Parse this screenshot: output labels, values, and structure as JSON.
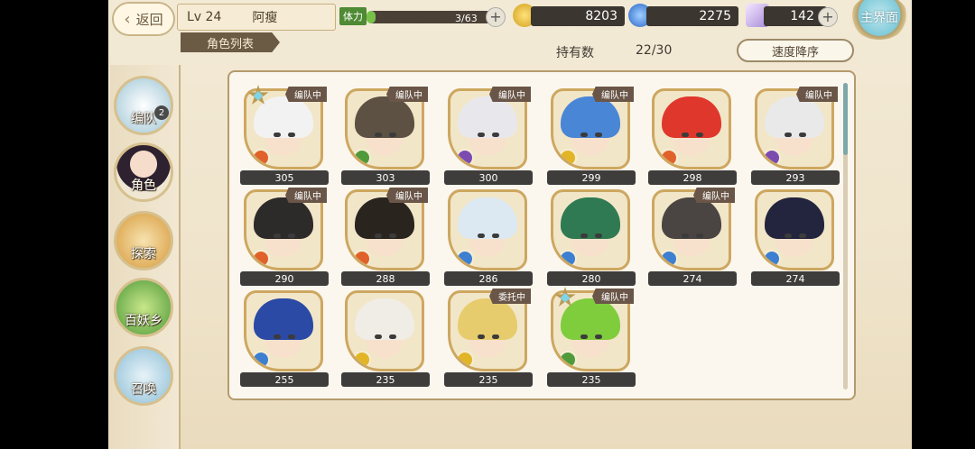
{
  "header": {
    "back_label": "返回",
    "level": "Lv 24",
    "player_name": "阿瘦",
    "section_tab": "角色列表",
    "stamina_label": "体力",
    "stamina_value": "3/63",
    "stamina_fill": 0.05,
    "gold": "8203",
    "soul": "2275",
    "crystal": "142",
    "home_label": "主界面"
  },
  "toolbar": {
    "count_label": "持有数",
    "count_value": "22/30",
    "sort_label": "速度降序"
  },
  "sidebar": {
    "items": [
      {
        "label": "编队",
        "icon": "formation-icon",
        "badge": "2"
      },
      {
        "label": "角色",
        "icon": "character-icon"
      },
      {
        "label": "探索",
        "icon": "explore-icon"
      },
      {
        "label": "百妖乡",
        "icon": "village-icon"
      },
      {
        "label": "召唤",
        "icon": "summon-icon"
      }
    ]
  },
  "colors": {
    "fire": "#e0622a",
    "wind": "#4f9a3a",
    "water": "#3d7fd0",
    "light": "#e1b526",
    "dark": "#7b4bb0"
  },
  "characters": [
    {
      "score": "305",
      "tag": "编队中",
      "star": true,
      "element": "fire",
      "hair": "#f2f2f2"
    },
    {
      "score": "303",
      "tag": "编队中",
      "element": "wind",
      "hair": "#5d5143"
    },
    {
      "score": "300",
      "tag": "编队中",
      "element": "dark",
      "hair": "#e8e8ec"
    },
    {
      "score": "299",
      "tag": "编队中",
      "element": "light",
      "hair": "#4a86d6"
    },
    {
      "score": "298",
      "tag": "",
      "element": "fire",
      "hair": "#e0372c"
    },
    {
      "score": "293",
      "tag": "编队中",
      "element": "dark",
      "hair": "#e9e9e9"
    },
    {
      "score": "290",
      "tag": "编队中",
      "element": "fire",
      "hair": "#2d2a2a"
    },
    {
      "score": "288",
      "tag": "编队中",
      "element": "fire",
      "hair": "#2a241f"
    },
    {
      "score": "286",
      "tag": "",
      "element": "water",
      "hair": "#dde9f2"
    },
    {
      "score": "280",
      "tag": "",
      "element": "water",
      "hair": "#2f7a52"
    },
    {
      "score": "274",
      "tag": "编队中",
      "element": "water",
      "hair": "#4a4542"
    },
    {
      "score": "274",
      "tag": "",
      "element": "water",
      "hair": "#22253d"
    },
    {
      "score": "255",
      "tag": "",
      "element": "water",
      "hair": "#2b4aa6"
    },
    {
      "score": "235",
      "tag": "",
      "element": "light",
      "hair": "#f0ece6"
    },
    {
      "score": "235",
      "tag": "委托中",
      "element": "light",
      "hair": "#e7cc6e"
    },
    {
      "score": "235",
      "tag": "编队中",
      "star": true,
      "element": "wind",
      "hair": "#7fcc3d"
    }
  ]
}
